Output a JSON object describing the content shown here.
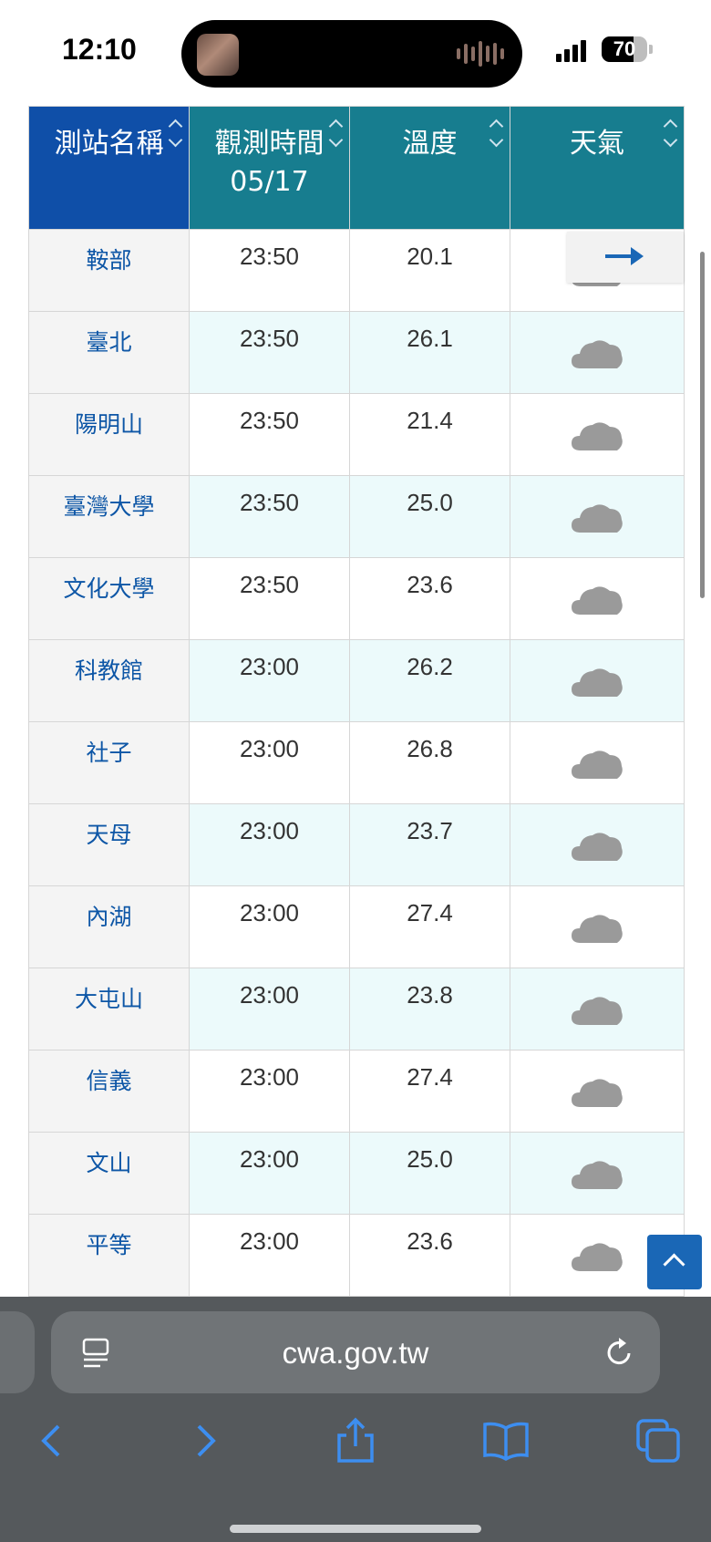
{
  "status_bar": {
    "time": "12:10",
    "battery": "70",
    "battery_level": 0.7
  },
  "table": {
    "headers": {
      "station": "測站名稱",
      "obs_time_line1": "觀測時間",
      "obs_time_line2": "05/17",
      "temperature": "溫度",
      "weather": "天氣"
    },
    "rows": [
      {
        "station": "鞍部",
        "time": "23:50",
        "temp": "20.1",
        "weather_icon": "cloud-icon"
      },
      {
        "station": "臺北",
        "time": "23:50",
        "temp": "26.1",
        "weather_icon": "cloud-icon"
      },
      {
        "station": "陽明山",
        "time": "23:50",
        "temp": "21.4",
        "weather_icon": "cloud-icon"
      },
      {
        "station": "臺灣大學",
        "time": "23:50",
        "temp": "25.0",
        "weather_icon": "cloud-icon"
      },
      {
        "station": "文化大學",
        "time": "23:50",
        "temp": "23.6",
        "weather_icon": "cloud-icon"
      },
      {
        "station": "科教館",
        "time": "23:00",
        "temp": "26.2",
        "weather_icon": "cloud-icon"
      },
      {
        "station": "社子",
        "time": "23:00",
        "temp": "26.8",
        "weather_icon": "cloud-icon"
      },
      {
        "station": "天母",
        "time": "23:00",
        "temp": "23.7",
        "weather_icon": "cloud-icon"
      },
      {
        "station": "內湖",
        "time": "23:00",
        "temp": "27.4",
        "weather_icon": "cloud-icon"
      },
      {
        "station": "大屯山",
        "time": "23:00",
        "temp": "23.8",
        "weather_icon": "cloud-icon"
      },
      {
        "station": "信義",
        "time": "23:00",
        "temp": "27.4",
        "weather_icon": "cloud-icon"
      },
      {
        "station": "文山",
        "time": "23:00",
        "temp": "25.0",
        "weather_icon": "cloud-icon"
      },
      {
        "station": "平等",
        "time": "23:00",
        "temp": "23.6",
        "weather_icon": "cloud-icon"
      }
    ]
  },
  "colors": {
    "station_header": "#0f4fa8",
    "header": "#177d8f",
    "station_text": "#0d56a6",
    "alt_row": "#ecfafb",
    "back_to_top": "#1a67b6",
    "browser_chrome": "#55595c",
    "toolbar_icon": "#3d8ef0"
  },
  "browser": {
    "url": "cwa.gov.tw",
    "icons": [
      "reader-icon",
      "reload-icon",
      "back-icon",
      "forward-icon",
      "share-icon",
      "bookmarks-icon",
      "tabs-icon"
    ]
  },
  "floating": {
    "arrow_icon": "arrow-right-icon",
    "back_to_top_icon": "chevron-up-icon"
  }
}
